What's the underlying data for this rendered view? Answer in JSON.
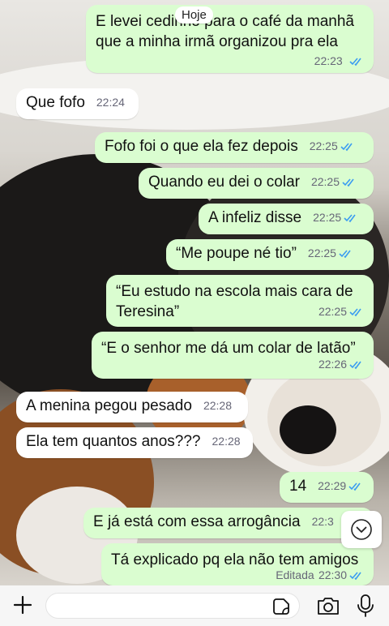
{
  "date_chip": "Hoje",
  "messages": [
    {
      "dir": "out",
      "text": "E levei cedinho para o café da manhã que a minha irmã organizou pra ela",
      "time": "22:23"
    },
    {
      "dir": "in",
      "text": "Que fofo",
      "time": "22:24"
    },
    {
      "dir": "out",
      "text": "Fofo foi o que ela fez depois",
      "time": "22:25"
    },
    {
      "dir": "out",
      "text": "Quando eu dei o colar",
      "time": "22:25"
    },
    {
      "dir": "out",
      "text": "A infeliz disse",
      "time": "22:25"
    },
    {
      "dir": "out",
      "text": "“Me poupe né tio”",
      "time": "22:25"
    },
    {
      "dir": "out",
      "text": "“Eu estudo na escola mais cara de Teresina”",
      "time": "22:25"
    },
    {
      "dir": "out",
      "text": "“E o senhor me dá um colar de latão”",
      "time": "22:26"
    },
    {
      "dir": "in",
      "text": "A menina pegou pesado",
      "time": "22:28"
    },
    {
      "dir": "in",
      "text": "Ela tem quantos anos???",
      "time": "22:28"
    },
    {
      "dir": "out",
      "text": "14",
      "time": "22:29"
    },
    {
      "dir": "out",
      "text": "E já está com essa arrogância",
      "time": "22:3"
    },
    {
      "dir": "out",
      "text": "Tá explicado pq ela não tem amigos",
      "time": "22:30",
      "edited": "Editada"
    }
  ],
  "icons": {
    "read": "double-check-icon",
    "scroll": "chevron-down-icon",
    "attach": "plus-icon",
    "sticker": "sticker-icon",
    "camera": "camera-icon",
    "mic": "microphone-icon"
  },
  "colors": {
    "outgoing": "#dafdd0",
    "incoming": "#ffffff",
    "read_tick": "#3b9cf1"
  }
}
